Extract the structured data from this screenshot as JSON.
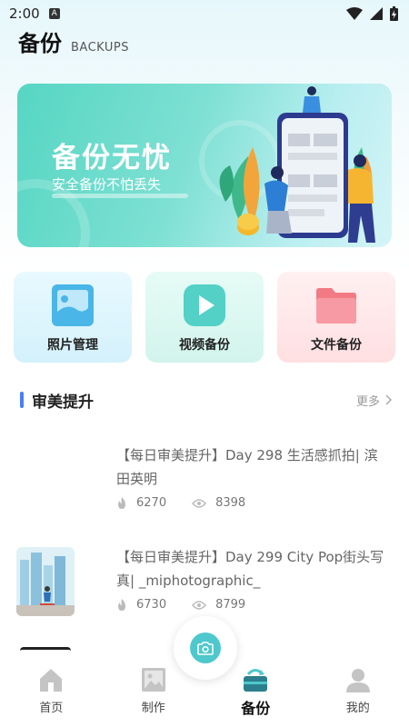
{
  "status_bar": {
    "time": "2:00",
    "indicator": "A"
  },
  "header": {
    "title": "备份",
    "subtitle": "BACKUPS"
  },
  "banner": {
    "title": "备份无忧",
    "subtitle": "安全备份不怕丢失"
  },
  "cards": [
    {
      "label": "照片管理",
      "icon": "photo-icon"
    },
    {
      "label": "视频备份",
      "icon": "play-icon"
    },
    {
      "label": "文件备份",
      "icon": "folder-icon"
    }
  ],
  "section": {
    "title": "审美提升",
    "more": "更多"
  },
  "articles": [
    {
      "title": "【每日审美提升】Day 298 生活感抓拍| 滨田英明",
      "likes": "6270",
      "views": "8398"
    },
    {
      "title": "【每日审美提升】Day 299 City Pop街头写真| _miphotographic_",
      "likes": "6730",
      "views": "8799"
    }
  ],
  "nav": {
    "items": [
      {
        "label": "首页",
        "icon": "home-icon"
      },
      {
        "label": "制作",
        "icon": "image-edit-icon"
      },
      {
        "label": "备份",
        "icon": "backup-icon",
        "active": true
      },
      {
        "label": "我的",
        "icon": "user-icon"
      }
    ]
  },
  "colors": {
    "accent": "#4ec8cd",
    "section_bar": "#4a7ef5"
  }
}
